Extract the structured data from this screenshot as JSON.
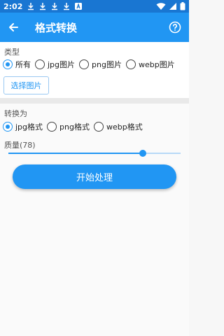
{
  "status_bar": {
    "time": "2:02"
  },
  "app_bar": {
    "title": "格式转换"
  },
  "type_section": {
    "label": "类型",
    "options": [
      {
        "label": "所有",
        "checked": true
      },
      {
        "label": "jpg图片",
        "checked": false
      },
      {
        "label": "png图片",
        "checked": false
      },
      {
        "label": "webp图片",
        "checked": false
      }
    ],
    "select_button": "选择图片"
  },
  "convert_section": {
    "label": "转换为",
    "options": [
      {
        "label": "jpg格式",
        "checked": true
      },
      {
        "label": "png格式",
        "checked": false
      },
      {
        "label": "webp格式",
        "checked": false
      }
    ]
  },
  "quality": {
    "label": "质量(78)",
    "value": 78,
    "max": 100
  },
  "start_button": "开始处理",
  "colors": {
    "primary": "#2196f3",
    "status_bar": "#1976d2"
  }
}
